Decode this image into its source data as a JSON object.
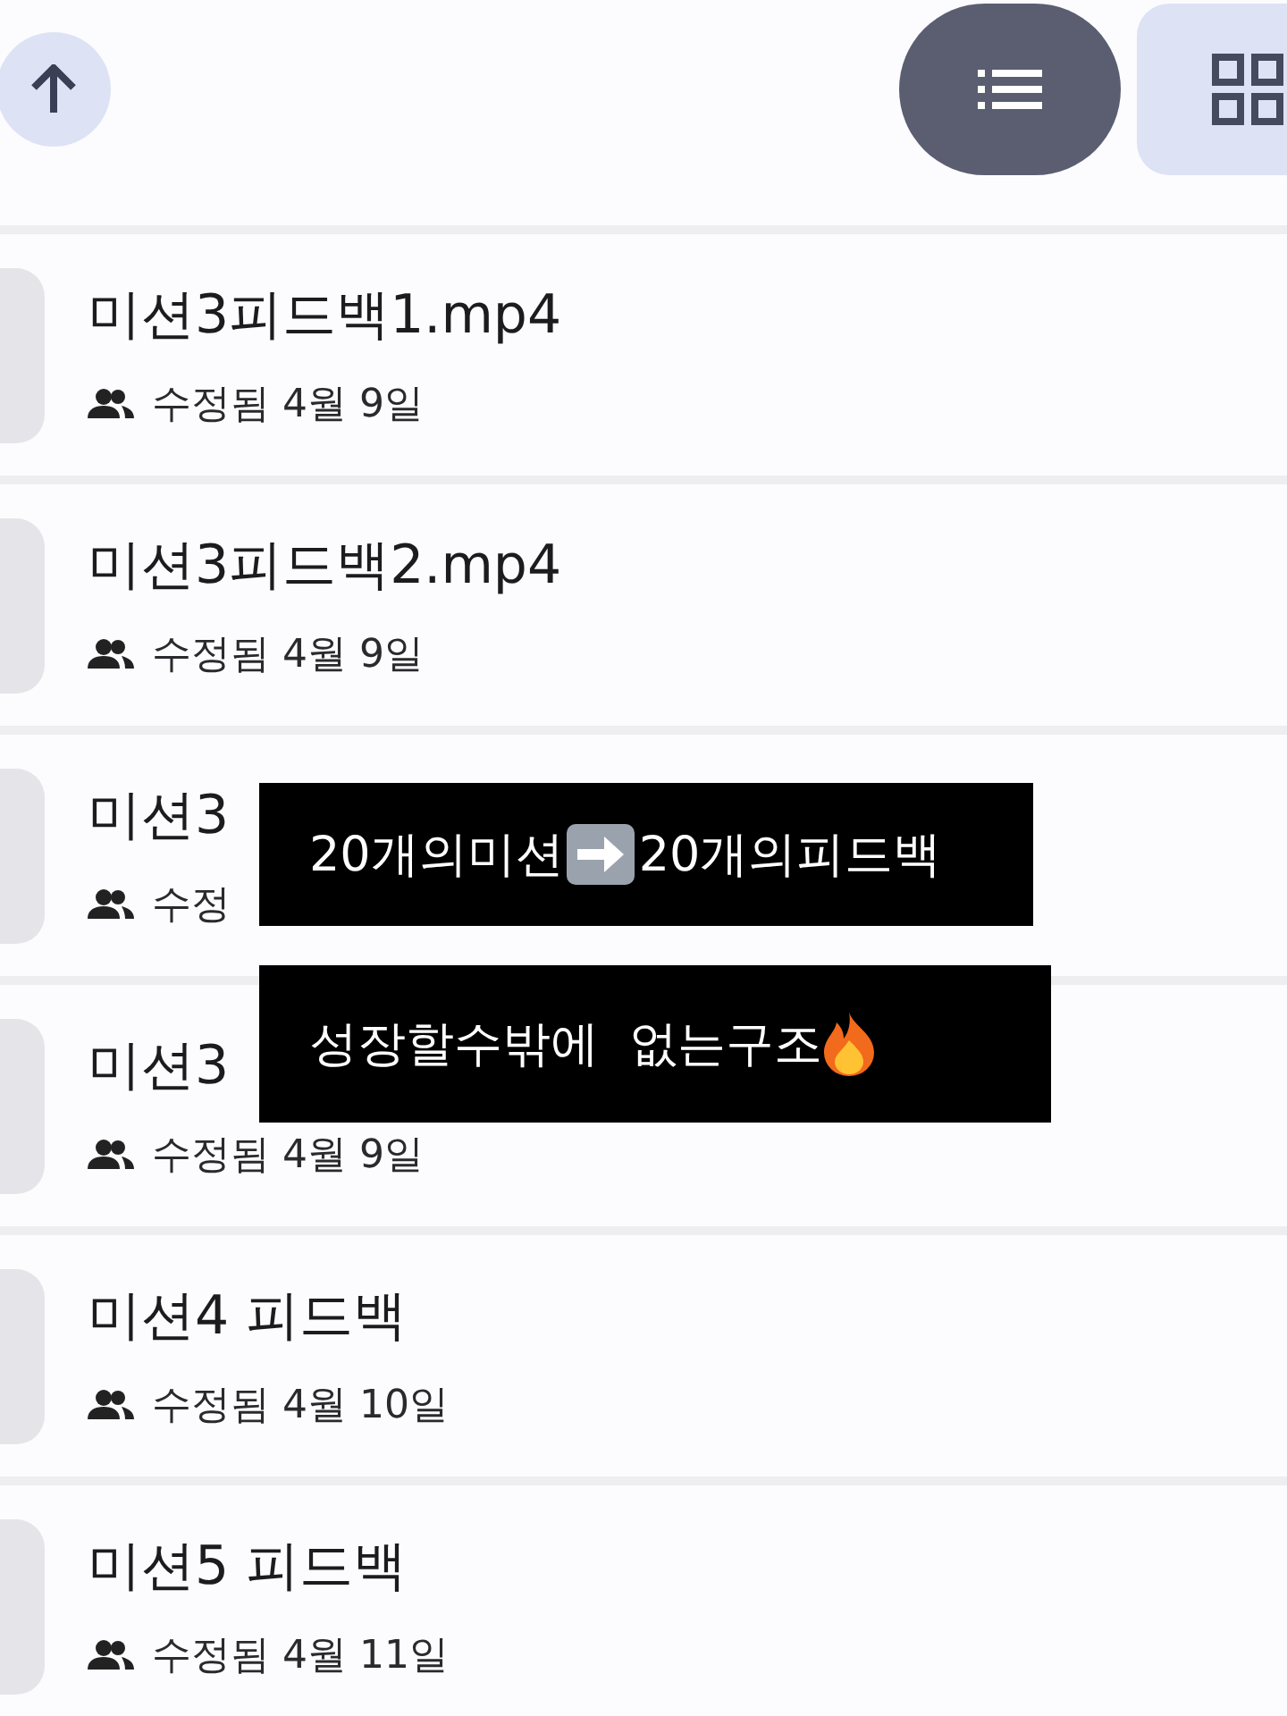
{
  "toolbar": {
    "view_toggle": [
      {
        "selected": true
      },
      {
        "selected": false
      }
    ]
  },
  "files": [
    {
      "title": "미션3피드백1.mp4",
      "modified": "수정됨 4월 9일"
    },
    {
      "title": "미션3피드백2.mp4",
      "modified": "수정됨 4월 9일"
    },
    {
      "title": "미션3",
      "modified": "수정"
    },
    {
      "title": "미션3",
      "modified": "수정됨 4월 9일"
    },
    {
      "title": "미션4 피드백",
      "modified": "수정됨 4월 10일"
    },
    {
      "title": "미션5 피드백",
      "modified": "수정됨 4월 11일"
    }
  ],
  "captions": [
    {
      "kind": "arrow",
      "before": "20개의미션",
      "after": "20개의피드백"
    },
    {
      "kind": "fire",
      "before": "성장할수밖에  없는구조"
    }
  ]
}
